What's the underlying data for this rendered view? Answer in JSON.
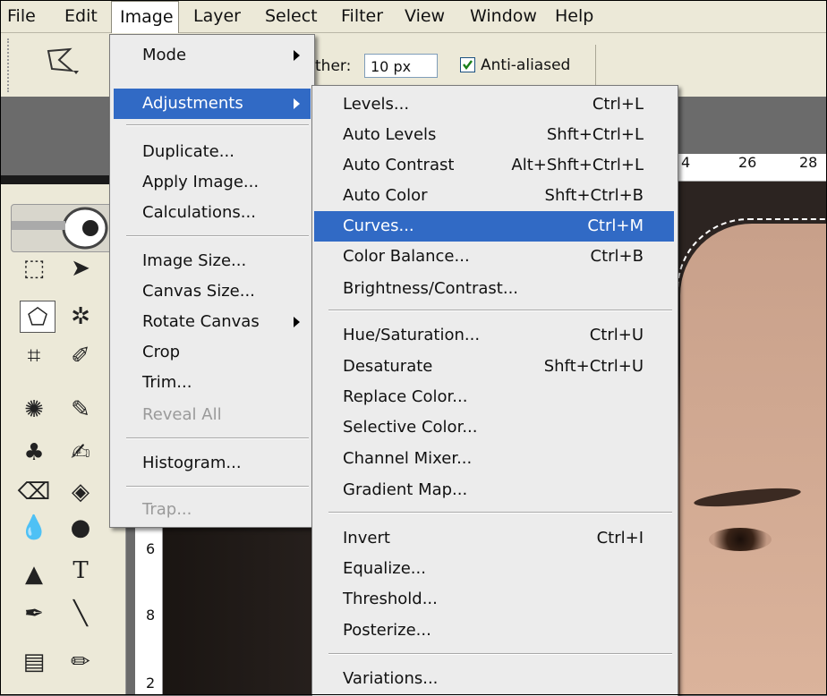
{
  "menubar": {
    "items": [
      "File",
      "Edit",
      "Image",
      "Layer",
      "Select",
      "Filter",
      "View",
      "Window",
      "Help"
    ]
  },
  "options_bar": {
    "feather_label": "ther:",
    "feather_value": "10 px",
    "anti_aliased_label": "Anti-aliased",
    "anti_aliased_checked": true
  },
  "image_menu": {
    "items": [
      {
        "label": "Mode"
      },
      {
        "label": "Adjustments"
      },
      {
        "label": "Duplicate..."
      },
      {
        "label": "Apply Image..."
      },
      {
        "label": "Calculations..."
      },
      {
        "label": "Image Size..."
      },
      {
        "label": "Canvas Size..."
      },
      {
        "label": "Rotate Canvas"
      },
      {
        "label": "Crop"
      },
      {
        "label": "Trim..."
      },
      {
        "label": "Reveal All"
      },
      {
        "label": "Histogram..."
      },
      {
        "label": "Trap..."
      }
    ]
  },
  "adjustments_menu": {
    "items": [
      {
        "label": "Levels...",
        "shortcut": "Ctrl+L"
      },
      {
        "label": "Auto Levels",
        "shortcut": "Shft+Ctrl+L"
      },
      {
        "label": "Auto Contrast",
        "shortcut": "Alt+Shft+Ctrl+L"
      },
      {
        "label": "Auto Color",
        "shortcut": "Shft+Ctrl+B"
      },
      {
        "label": "Curves...",
        "shortcut": "Ctrl+M"
      },
      {
        "label": "Color Balance...",
        "shortcut": "Ctrl+B"
      },
      {
        "label": "Brightness/Contrast...",
        "shortcut": ""
      },
      {
        "label": "Hue/Saturation...",
        "shortcut": "Ctrl+U"
      },
      {
        "label": "Desaturate",
        "shortcut": "Shft+Ctrl+U"
      },
      {
        "label": "Replace Color...",
        "shortcut": ""
      },
      {
        "label": "Selective Color...",
        "shortcut": ""
      },
      {
        "label": "Channel Mixer...",
        "shortcut": ""
      },
      {
        "label": "Gradient Map...",
        "shortcut": ""
      },
      {
        "label": "Invert",
        "shortcut": "Ctrl+I"
      },
      {
        "label": "Equalize...",
        "shortcut": ""
      },
      {
        "label": "Threshold...",
        "shortcut": ""
      },
      {
        "label": "Posterize...",
        "shortcut": ""
      },
      {
        "label": "Variations...",
        "shortcut": ""
      }
    ]
  },
  "rulers": {
    "horizontal": [
      "4",
      "26",
      "28"
    ],
    "vertical": [
      "6",
      "8",
      "2"
    ]
  },
  "tools": {
    "type_tool_glyph": "T"
  },
  "colors": {
    "highlight": "#316ac5",
    "menu_bg": "#ececec",
    "chrome_bg": "#ece9d8"
  }
}
